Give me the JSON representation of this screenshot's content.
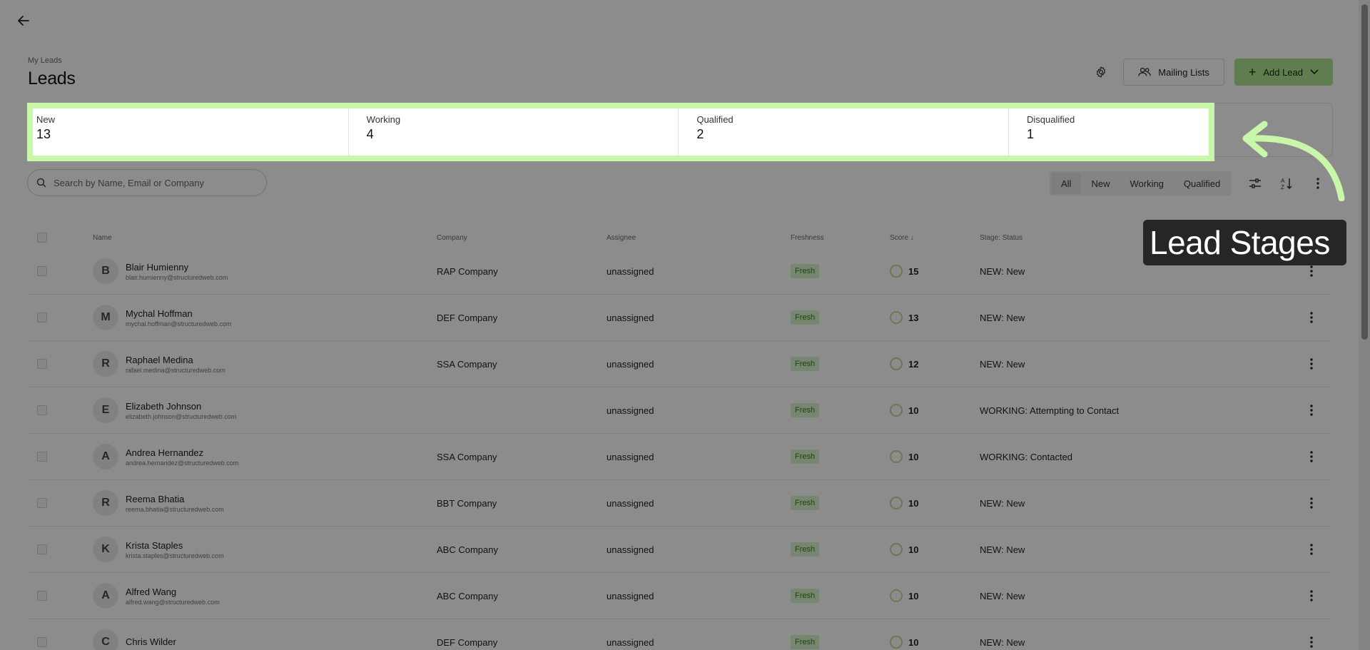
{
  "header": {
    "breadcrumb": "My Leads",
    "title": "Leads",
    "settings_icon": "gear-icon",
    "mailing_lists_label": "Mailing Lists",
    "add_lead_label": "Add Lead"
  },
  "stats": [
    {
      "label": "New",
      "value": "13"
    },
    {
      "label": "Working",
      "value": "4"
    },
    {
      "label": "Qualified",
      "value": "2"
    },
    {
      "label": "Disqualified",
      "value": "1"
    }
  ],
  "search": {
    "placeholder": "Search by Name, Email or Company"
  },
  "filters": [
    "All",
    "New",
    "Working",
    "Qualified"
  ],
  "active_filter": "All",
  "table": {
    "columns": {
      "name": "Name",
      "company": "Company",
      "assignee": "Assignee",
      "freshness": "Freshness",
      "score": "Score ↓",
      "stage": "Stage: Status"
    },
    "rows": [
      {
        "initial": "B",
        "name": "Blair Humienny",
        "email": "blair.humienny@structuredweb.com",
        "company": "RAP Company",
        "assignee": "unassigned",
        "freshness": "Fresh",
        "score": "15",
        "stage": "NEW: New"
      },
      {
        "initial": "M",
        "name": "Mychal Hoffman",
        "email": "mychal.hoffman@structuredweb.com",
        "company": "DEF Company",
        "assignee": "unassigned",
        "freshness": "Fresh",
        "score": "13",
        "stage": "NEW: New"
      },
      {
        "initial": "R",
        "name": "Raphael Medina",
        "email": "rafael.medina@structuredweb.com",
        "company": "SSA Company",
        "assignee": "unassigned",
        "freshness": "Fresh",
        "score": "12",
        "stage": "NEW: New"
      },
      {
        "initial": "E",
        "name": "Elizabeth Johnson",
        "email": "elizabeth.johnson@structuredweb.com",
        "company": "",
        "assignee": "unassigned",
        "freshness": "Fresh",
        "score": "10",
        "stage": "WORKING: Attempting to Contact"
      },
      {
        "initial": "A",
        "name": "Andrea Hernandez",
        "email": "andrea.hernandez@structuredweb.com",
        "company": "SSA Company",
        "assignee": "unassigned",
        "freshness": "Fresh",
        "score": "10",
        "stage": "WORKING: Contacted"
      },
      {
        "initial": "R",
        "name": "Reema Bhatia",
        "email": "reema.bhatia@structuredweb.com",
        "company": "BBT Company",
        "assignee": "unassigned",
        "freshness": "Fresh",
        "score": "10",
        "stage": "NEW: New"
      },
      {
        "initial": "K",
        "name": "Krista Staples",
        "email": "krista.staples@structuredweb.com",
        "company": "ABC Company",
        "assignee": "unassigned",
        "freshness": "Fresh",
        "score": "10",
        "stage": "NEW: New"
      },
      {
        "initial": "A",
        "name": "Alfred Wang",
        "email": "alfred.wang@structuredweb.com",
        "company": "ABC Company",
        "assignee": "unassigned",
        "freshness": "Fresh",
        "score": "10",
        "stage": "NEW: New"
      },
      {
        "initial": "C",
        "name": "Chris Wilder",
        "email": "",
        "company": "DEF Company",
        "assignee": "unassigned",
        "freshness": "Fresh",
        "score": "10",
        "stage": "NEW: New"
      }
    ]
  },
  "callout": {
    "text": "Lead Stages"
  },
  "colors": {
    "accent": "#aee38f",
    "highlight_border": "#c9f7a9",
    "badge_bg": "#d9f5c8",
    "callout_bg": "#262626"
  }
}
